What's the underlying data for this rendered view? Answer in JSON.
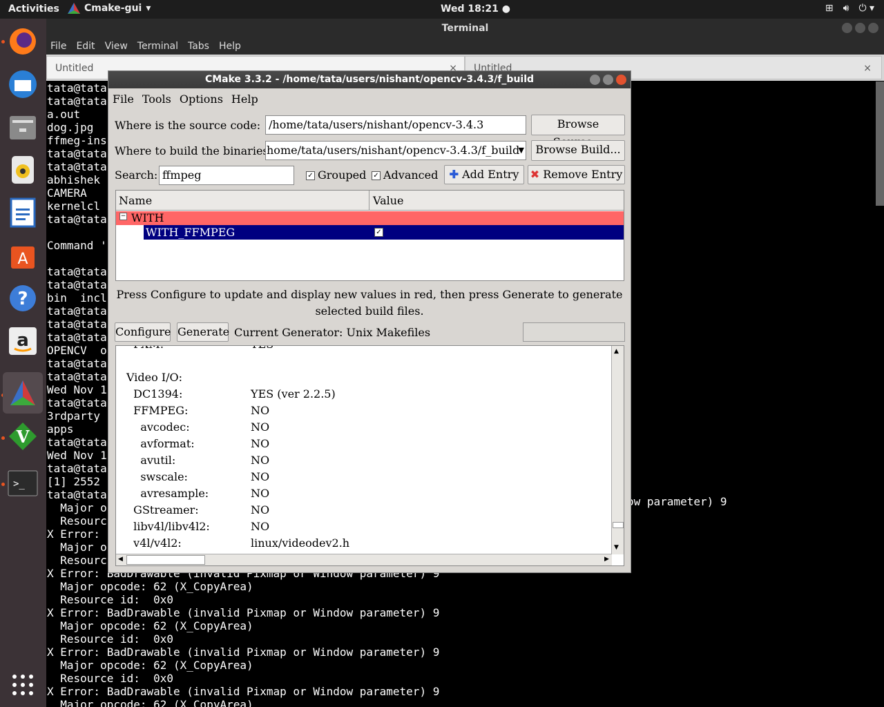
{
  "topbar": {
    "activities": "Activities",
    "app_name": "Cmake-gui",
    "clock": "Wed 18:21"
  },
  "dock": {
    "items": [
      "firefox-icon",
      "thunderbird-icon",
      "files-icon",
      "rhythmbox-icon",
      "writer-icon",
      "software-icon",
      "help-icon",
      "amazon-icon",
      "cmake-icon",
      "vim-icon",
      "terminal-icon",
      "apps-grid-icon"
    ]
  },
  "terminal": {
    "title": "Terminal",
    "menu": [
      "File",
      "Edit",
      "View",
      "Terminal",
      "Tabs",
      "Help"
    ],
    "tabs": [
      "Untitled",
      "Untitled"
    ],
    "lines_left": [
      "tata@tata",
      "tata@tata",
      "a.out",
      "dog.jpg",
      "ffmeg-ins",
      "tata@tata",
      "tata@tata",
      "abhishek",
      "CAMERA",
      "kernelcl",
      "tata@tata",
      "",
      "Command '",
      "",
      "tata@tata",
      "tata@tata",
      "bin  incl",
      "tata@tata",
      "tata@tata",
      "tata@tata",
      "OPENCV  o",
      "tata@tata",
      "tata@tata",
      "Wed Nov 1",
      "tata@tata",
      "3rdparty",
      "apps",
      "tata@tata",
      "Wed Nov 1",
      "tata@tata",
      "[1] 2552",
      "tata@tata",
      "  Major o",
      "  Resourc",
      "X Error: ",
      "  Major o",
      "  Resourc"
    ],
    "right_fragment": "ow parameter) 9",
    "lines_bottom": [
      "X Error: BadDrawable (invalid Pixmap or Window parameter) 9",
      "  Major opcode: 62 (X_CopyArea)",
      "  Resource id:  0x0",
      "X Error: BadDrawable (invalid Pixmap or Window parameter) 9",
      "  Major opcode: 62 (X_CopyArea)",
      "  Resource id:  0x0",
      "X Error: BadDrawable (invalid Pixmap or Window parameter) 9",
      "  Major opcode: 62 (X_CopyArea)",
      "  Resource id:  0x0",
      "X Error: BadDrawable (invalid Pixmap or Window parameter) 9",
      "  Major opcode: 62 (X_CopyArea)"
    ]
  },
  "cmake": {
    "title": "CMake 3.3.2 - /home/tata/users/nishant/opencv-3.4.3/f_build",
    "menu": [
      "File",
      "Tools",
      "Options",
      "Help"
    ],
    "source_label": "Where is the source code:",
    "source_value": "/home/tata/users/nishant/opencv-3.4.3",
    "browse_source": "Browse Source...",
    "build_label": "Where to build the binaries:",
    "build_value": "home/tata/users/nishant/opencv-3.4.3/f_build",
    "browse_build": "Browse Build...",
    "search_label": "Search:",
    "search_value": "ffmpeg",
    "grouped": "Grouped",
    "advanced": "Advanced",
    "add_entry": "Add Entry",
    "remove_entry": "Remove Entry",
    "col_name": "Name",
    "col_value": "Value",
    "group_name": "WITH",
    "entry_name": "WITH_FFMPEG",
    "hint": "Press Configure to update and display new values in red, then press Generate to generate selected build files.",
    "configure": "Configure",
    "generate": "Generate",
    "generator": "Current Generator: Unix Makefiles",
    "log": [
      {
        "k": "  PXM:",
        "v": "YES"
      },
      {
        "k": "",
        "v": ""
      },
      {
        "k": "Video I/O:",
        "v": ""
      },
      {
        "k": "  DC1394:",
        "v": "YES (ver 2.2.5)"
      },
      {
        "k": "  FFMPEG:",
        "v": "NO"
      },
      {
        "k": "    avcodec:",
        "v": "NO"
      },
      {
        "k": "    avformat:",
        "v": "NO"
      },
      {
        "k": "    avutil:",
        "v": "NO"
      },
      {
        "k": "    swscale:",
        "v": "NO"
      },
      {
        "k": "    avresample:",
        "v": "NO"
      },
      {
        "k": "  GStreamer:",
        "v": "NO"
      },
      {
        "k": "  libv4l/libv4l2:",
        "v": "NO"
      },
      {
        "k": "  v4l/v4l2:",
        "v": "linux/videodev2.h"
      }
    ]
  }
}
